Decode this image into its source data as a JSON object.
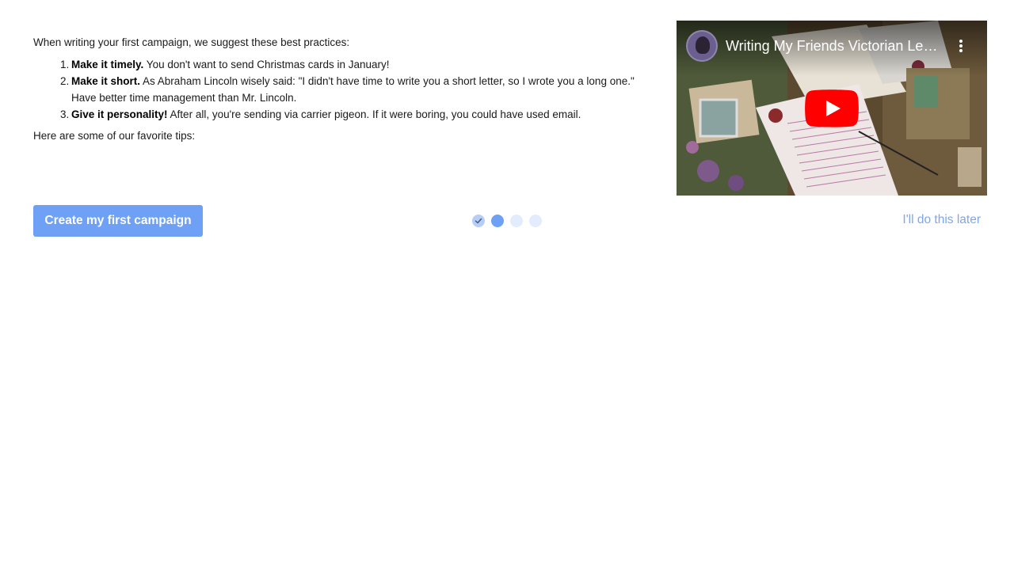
{
  "content": {
    "intro": "When writing your first campaign, we suggest these best practices:",
    "practices": [
      {
        "title": "Make it timely.",
        "text": " You don't want to send Christmas cards in January!"
      },
      {
        "title": "Make it short.",
        "text": " As Abraham Lincoln wisely said: \"I didn't have time to write you a short letter, so I wrote you a long one.\" Have better time management than Mr. Lincoln."
      },
      {
        "title": "Give it personality!",
        "text": " After all, you're sending via carrier pigeon. If it were boring, you could have used email."
      }
    ],
    "tips_heading": "Here are some of our favorite tips:"
  },
  "video": {
    "title": "Writing My Friends Victorian Letters",
    "play_icon": "youtube-play-icon",
    "menu_icon": "more-vert-icon"
  },
  "actions": {
    "primary_label": "Create my first campaign",
    "skip_label": "I'll do this later"
  },
  "progress": {
    "total_steps": 4,
    "completed_steps": 1,
    "current_step": 2
  },
  "colors": {
    "accent": "#6ea0f5",
    "link": "#7ea6ee",
    "step_inactive": "#e3ecfc",
    "step_done": "#b6cdf6"
  }
}
